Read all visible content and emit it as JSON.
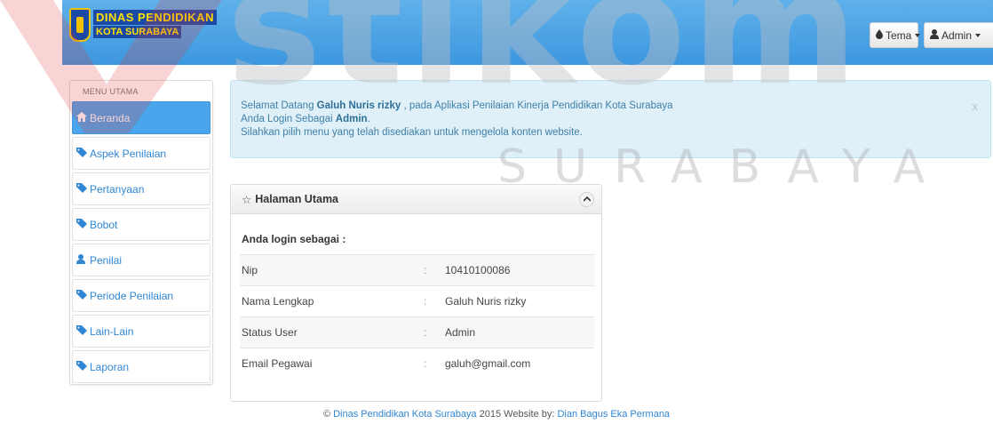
{
  "watermark": {
    "big": "stikom",
    "small": "SURABAYA"
  },
  "header": {
    "logo_line1": "DINAS PENDIDIKAN",
    "logo_line2": "KOTA SURABAYA",
    "theme_button": "Tema",
    "theme_icon": "tint-icon",
    "user_button": "Admin",
    "user_icon": "user-icon"
  },
  "sidebar": {
    "header": "MENU UTAMA",
    "items": [
      {
        "label": "Beranda",
        "icon": "home-icon",
        "active": true
      },
      {
        "label": "Aspek Penilaian",
        "icon": "tags-icon",
        "active": false
      },
      {
        "label": "Pertanyaan",
        "icon": "tags-icon",
        "active": false
      },
      {
        "label": "Bobot",
        "icon": "tags-icon",
        "active": false
      },
      {
        "label": "Penilai",
        "icon": "user-icon",
        "active": false
      },
      {
        "label": "Periode Penilaian",
        "icon": "tags-icon",
        "active": false
      },
      {
        "label": "Lain-Lain",
        "icon": "tags-icon",
        "active": false
      },
      {
        "label": "Laporan",
        "icon": "tags-icon",
        "active": false
      }
    ]
  },
  "alert": {
    "greeting_prefix": "Selamat Datang",
    "user_name": "Galuh Nuris rizky",
    "greeting_suffix": ", pada Aplikasi Penilaian Kinerja Pendidikan Kota Surabaya",
    "login_prefix": "Anda Login Sebagai",
    "role": "Admin",
    "instruction": "Silahkan pilih menu yang telah disediakan untuk mengelola konten website.",
    "close": "x"
  },
  "panel": {
    "title": "Halaman Utama",
    "subtitle": "Anda login sebagai :",
    "rows": [
      {
        "label": "Nip",
        "sep": ":",
        "value": "10410100086"
      },
      {
        "label": "Nama Lengkap",
        "sep": ":",
        "value": "Galuh Nuris rizky"
      },
      {
        "label": "Status User",
        "sep": ":",
        "value": "Admin"
      },
      {
        "label": "Email Pegawai",
        "sep": ":",
        "value": "galuh@gmail.com"
      }
    ]
  },
  "footer": {
    "copyright": "©",
    "org": "Dinas Pendidikan Kota Surabaya",
    "middle": "2015 Website by:",
    "author": "Dian Bagus Eka Permana"
  },
  "colors": {
    "navbar": "#4aa5ec",
    "link": "#2f86d3",
    "alert_bg": "#dff0f8",
    "alert_text": "#3f7fa8"
  }
}
